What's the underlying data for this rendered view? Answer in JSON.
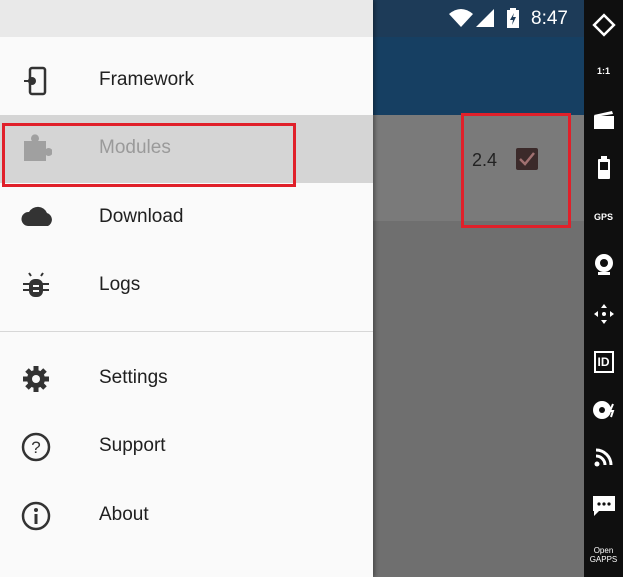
{
  "status_bar": {
    "time": "8:47"
  },
  "drawer": {
    "items": [
      {
        "label": "Framework",
        "icon": "phone-settings-icon"
      },
      {
        "label": "Modules",
        "icon": "puzzle-icon",
        "active": true
      },
      {
        "label": "Download",
        "icon": "cloud-icon"
      },
      {
        "label": "Logs",
        "icon": "bug-icon"
      },
      {
        "label": "Settings",
        "icon": "gear-icon"
      },
      {
        "label": "Support",
        "icon": "help-circle-icon"
      },
      {
        "label": "About",
        "icon": "info-circle-icon"
      }
    ]
  },
  "module_row": {
    "version": "2.4",
    "enabled": true
  },
  "emulator_toolbar": {
    "items": [
      {
        "name": "rotate-icon"
      },
      {
        "name": "pixel-perfect-icon",
        "text": "1:1"
      },
      {
        "name": "screen-record-icon"
      },
      {
        "name": "battery-icon"
      },
      {
        "name": "gps-icon",
        "text": "GPS"
      },
      {
        "name": "camera-icon"
      },
      {
        "name": "remote-control-icon"
      },
      {
        "name": "device-id-icon",
        "text": "ID"
      },
      {
        "name": "disk-icon"
      },
      {
        "name": "cast-icon"
      },
      {
        "name": "sms-icon"
      },
      {
        "name": "open-gapps-icon",
        "text": "Open GAPPS"
      }
    ]
  },
  "colors": {
    "highlight": "#e0202a",
    "appbar": "#163f62",
    "accent_text": "#202020"
  }
}
